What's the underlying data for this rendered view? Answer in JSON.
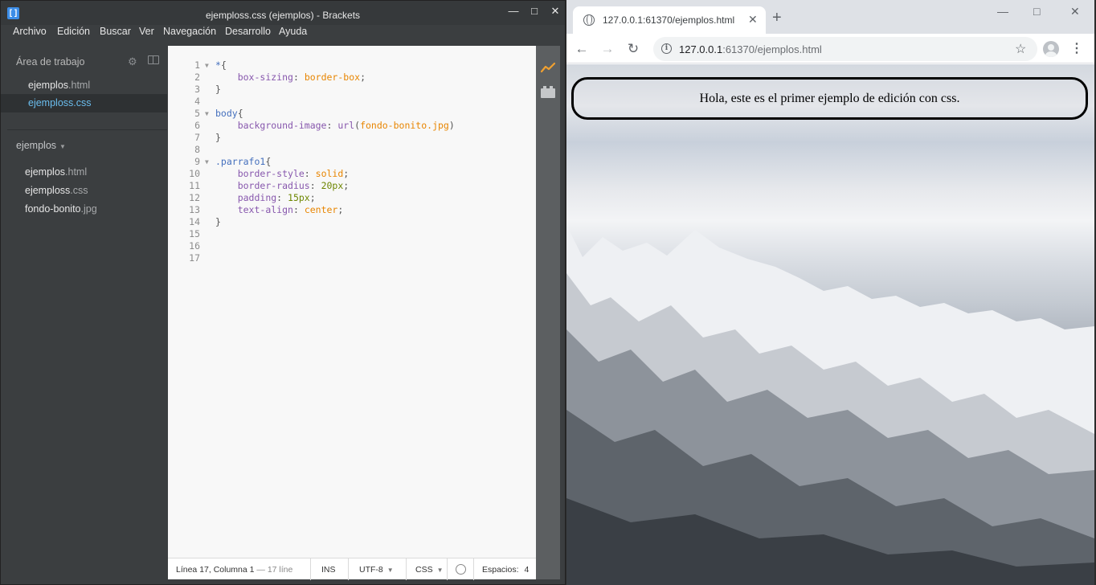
{
  "brackets": {
    "title": "ejemploss.css (ejemplos) - Brackets",
    "app_icon": "brackets-logo-icon",
    "menu": [
      "Archivo",
      "Edición",
      "Buscar",
      "Ver",
      "Navegación",
      "Desarrollo",
      "Ayuda"
    ],
    "workspace": {
      "title": "Área de trabajo",
      "files": [
        {
          "name": "ejemplos",
          "ext": ".html",
          "active": false
        },
        {
          "name": "ejemploss",
          "ext": ".css",
          "active": true
        }
      ]
    },
    "project": {
      "name": "ejemplos",
      "files": [
        {
          "name": "ejemplos",
          "ext": ".html"
        },
        {
          "name": "ejemploss",
          "ext": ".css"
        },
        {
          "name": "fondo-bonito",
          "ext": ".jpg"
        }
      ]
    },
    "code_lines": [
      {
        "n": "1",
        "fold": true,
        "parts": [
          [
            "t-sel",
            "*"
          ],
          [
            "t-punc",
            "{"
          ]
        ]
      },
      {
        "n": "2",
        "fold": false,
        "parts": [
          [
            "t-punc",
            "    "
          ],
          [
            "t-prop",
            "box-sizing"
          ],
          [
            "t-punc",
            ": "
          ],
          [
            "t-val",
            "border-box"
          ],
          [
            "t-punc",
            ";"
          ]
        ]
      },
      {
        "n": "3",
        "fold": false,
        "parts": [
          [
            "t-punc",
            "}"
          ]
        ]
      },
      {
        "n": "4",
        "fold": false,
        "parts": []
      },
      {
        "n": "5",
        "fold": true,
        "parts": [
          [
            "t-sel",
            "body"
          ],
          [
            "t-punc",
            "{"
          ]
        ]
      },
      {
        "n": "6",
        "fold": false,
        "parts": [
          [
            "t-punc",
            "    "
          ],
          [
            "t-prop",
            "background-image"
          ],
          [
            "t-punc",
            ": "
          ],
          [
            "t-prop",
            "url"
          ],
          [
            "t-punc",
            "("
          ],
          [
            "t-val",
            "fondo-bonito.jpg"
          ],
          [
            "t-punc",
            ")"
          ]
        ]
      },
      {
        "n": "7",
        "fold": false,
        "parts": [
          [
            "t-punc",
            "}"
          ]
        ]
      },
      {
        "n": "8",
        "fold": false,
        "parts": []
      },
      {
        "n": "9",
        "fold": true,
        "parts": [
          [
            "t-sel",
            ".parrafo1"
          ],
          [
            "t-punc",
            "{"
          ]
        ]
      },
      {
        "n": "10",
        "fold": false,
        "parts": [
          [
            "t-punc",
            "    "
          ],
          [
            "t-prop",
            "border-style"
          ],
          [
            "t-punc",
            ": "
          ],
          [
            "t-val",
            "solid"
          ],
          [
            "t-punc",
            ";"
          ]
        ]
      },
      {
        "n": "11",
        "fold": false,
        "parts": [
          [
            "t-punc",
            "    "
          ],
          [
            "t-prop",
            "border-radius"
          ],
          [
            "t-punc",
            ": "
          ],
          [
            "t-num",
            "20px"
          ],
          [
            "t-punc",
            ";"
          ]
        ]
      },
      {
        "n": "12",
        "fold": false,
        "parts": [
          [
            "t-punc",
            "    "
          ],
          [
            "t-prop",
            "padding"
          ],
          [
            "t-punc",
            ": "
          ],
          [
            "t-num",
            "15px"
          ],
          [
            "t-punc",
            ";"
          ]
        ]
      },
      {
        "n": "13",
        "fold": false,
        "parts": [
          [
            "t-punc",
            "    "
          ],
          [
            "t-prop",
            "text-align"
          ],
          [
            "t-punc",
            ": "
          ],
          [
            "t-val",
            "center"
          ],
          [
            "t-punc",
            ";"
          ]
        ]
      },
      {
        "n": "14",
        "fold": false,
        "parts": [
          [
            "t-punc",
            "}"
          ]
        ]
      },
      {
        "n": "15",
        "fold": false,
        "parts": []
      },
      {
        "n": "16",
        "fold": false,
        "parts": []
      },
      {
        "n": "17",
        "fold": false,
        "parts": []
      }
    ],
    "status": {
      "position": "Línea 17, Columna 1",
      "lines": " — 17 líne",
      "mode": "INS",
      "encoding": "UTF-8",
      "language": "CSS",
      "spaces_label": "Espacios:",
      "spaces_value": "4"
    },
    "toolbar_icons": [
      "live-preview-icon",
      "extension-manager-icon"
    ]
  },
  "chrome": {
    "tab_title": "127.0.0.1:61370/ejemplos.html",
    "url_host": "127.0.0.1",
    "url_rest": ":61370/ejemplos.html",
    "page_text": "Hola, este es el primer ejemplo de edición con css."
  }
}
